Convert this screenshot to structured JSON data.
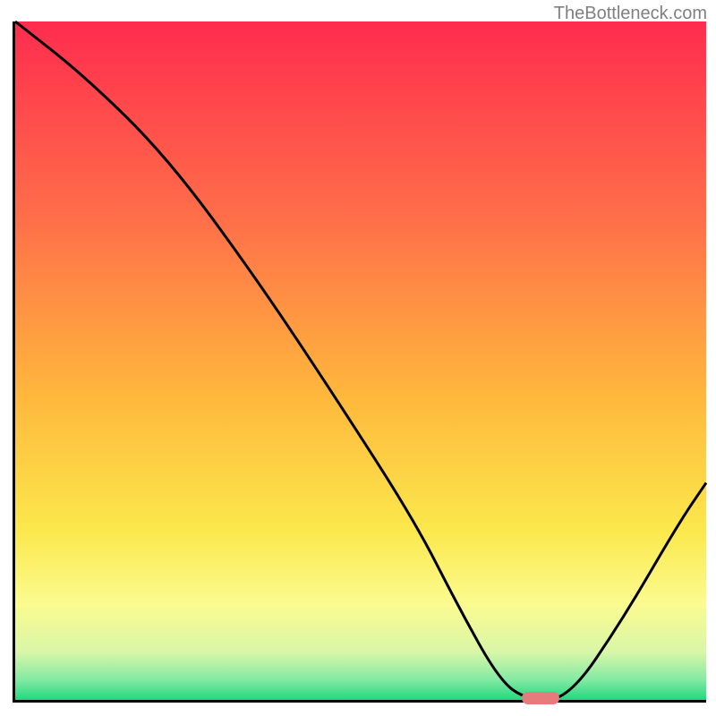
{
  "watermark": "TheBottleneck.com",
  "chart_data": {
    "type": "line",
    "title": "",
    "xlabel": "",
    "ylabel": "",
    "xlim": [
      0,
      100
    ],
    "ylim": [
      0,
      100
    ],
    "background": {
      "gradient_stops": [
        {
          "offset": 0,
          "color": "#ff2c4e"
        },
        {
          "offset": 30,
          "color": "#ff7149"
        },
        {
          "offset": 55,
          "color": "#ffb73c"
        },
        {
          "offset": 75,
          "color": "#fbe84c"
        },
        {
          "offset": 86,
          "color": "#fbfb90"
        },
        {
          "offset": 93,
          "color": "#d8f6a8"
        },
        {
          "offset": 97,
          "color": "#84eaa3"
        },
        {
          "offset": 100,
          "color": "#22d87f"
        }
      ]
    },
    "series": [
      {
        "name": "bottleneck-curve",
        "color": "#000000",
        "x": [
          0,
          10,
          22,
          35,
          48,
          58,
          64,
          70,
          74,
          80,
          88,
          96,
          100
        ],
        "y": [
          100,
          92,
          80,
          62,
          42,
          26,
          14,
          3,
          0,
          0,
          12,
          26,
          32
        ]
      }
    ],
    "annotations": [
      {
        "type": "pill",
        "name": "optimum-marker",
        "x": 76,
        "y": 0,
        "color": "#e77a7c"
      }
    ]
  }
}
